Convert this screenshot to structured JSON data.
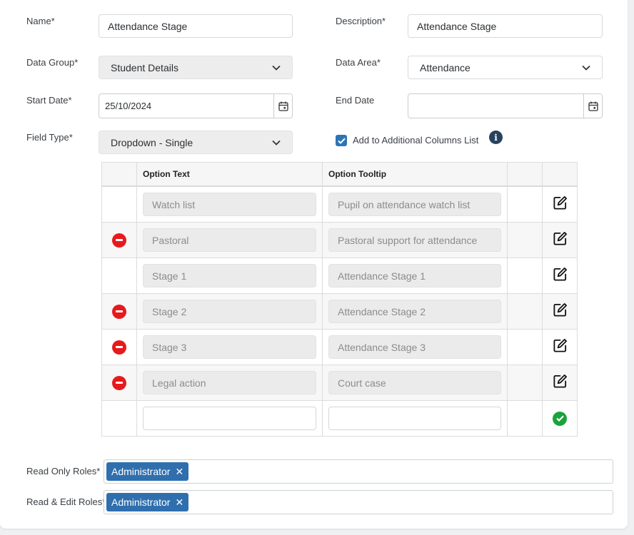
{
  "form": {
    "name_label": "Name*",
    "name_value": "Attendance Stage",
    "description_label": "Description*",
    "description_value": "Attendance Stage",
    "data_group_label": "Data Group*",
    "data_group_value": "Student Details",
    "data_area_label": "Data Area*",
    "data_area_value": "Attendance",
    "start_date_label": "Start Date*",
    "start_date_value": "25/10/2024",
    "end_date_label": "End Date",
    "end_date_value": "",
    "field_type_label": "Field Type*",
    "field_type_value": "Dropdown - Single",
    "additional_columns_label": "Add to Additional Columns List",
    "additional_columns_checked": true,
    "info_glyph": "i"
  },
  "options_table": {
    "headers": {
      "option_text": "Option Text",
      "option_tooltip": "Option Tooltip"
    },
    "rows": [
      {
        "text": "Watch list",
        "tooltip": "Pupil on attendance watch list",
        "removable": false
      },
      {
        "text": "Pastoral",
        "tooltip": "Pastoral support for attendance",
        "removable": true
      },
      {
        "text": "Stage 1",
        "tooltip": "Attendance Stage 1",
        "removable": false
      },
      {
        "text": "Stage 2",
        "tooltip": "Attendance Stage 2",
        "removable": true
      },
      {
        "text": "Stage 3",
        "tooltip": "Attendance Stage 3",
        "removable": true
      },
      {
        "text": "Legal action",
        "tooltip": "Court case",
        "removable": true
      }
    ],
    "new_row": {
      "text": "",
      "tooltip": ""
    }
  },
  "roles": {
    "read_only_label": "Read Only Roles*",
    "read_only_tags": [
      "Administrator"
    ],
    "read_edit_label": "Read & Edit Roles*",
    "read_edit_tags": [
      "Administrator"
    ],
    "remove_glyph": "✕"
  },
  "icons": {
    "remove": "remove-circle-icon",
    "edit": "edit-icon",
    "confirm": "check-circle-icon",
    "calendar": "calendar-icon",
    "chevron": "chevron-down-icon",
    "info": "info-icon"
  },
  "colors": {
    "primary": "#2f6fae",
    "danger": "#e8191c",
    "success": "#1aa33a",
    "info": "#27425e"
  }
}
